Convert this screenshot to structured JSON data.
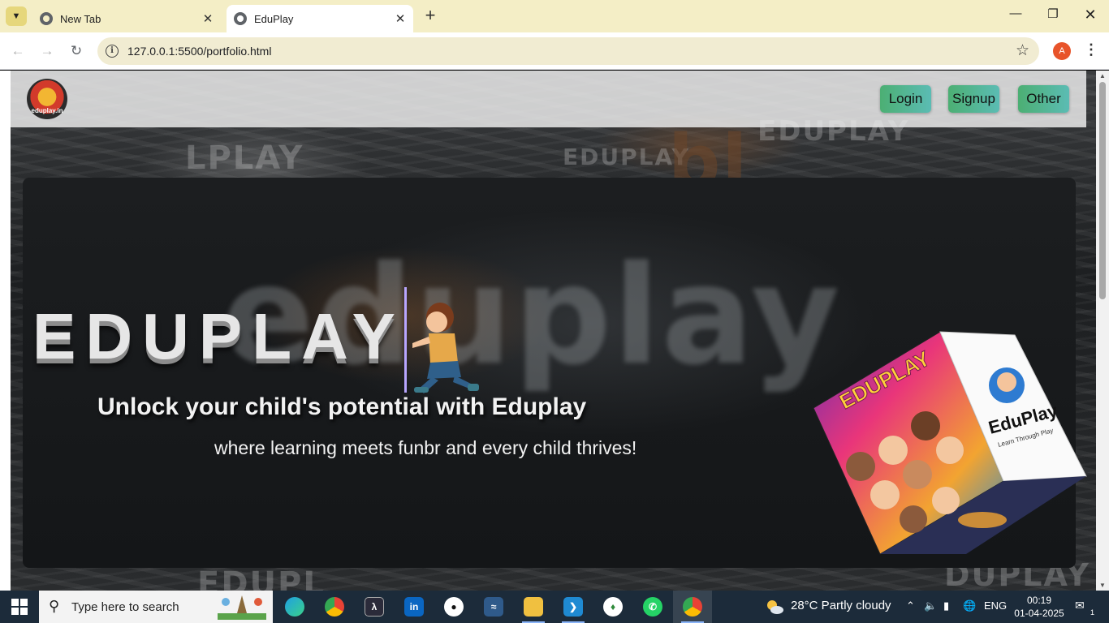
{
  "browser": {
    "tabs": [
      {
        "title": "New Tab",
        "active": false
      },
      {
        "title": "EduPlay",
        "active": true
      }
    ],
    "url": "127.0.0.1:5500/portfolio.html",
    "profile_initial": "A"
  },
  "site": {
    "logo_text": "eduplay.in",
    "nav": [
      {
        "label": "Login"
      },
      {
        "label": "Signup"
      },
      {
        "label": "Other"
      }
    ]
  },
  "hero": {
    "title": "EDUPLAY",
    "background_word": "eduplay",
    "tagline": "Unlock your child's potential with Eduplay",
    "subtitle": "where learning meets funbr and every child thrives!",
    "cube_front_title": "EDUPLAY",
    "cube_side_title": "EduPlay",
    "cube_side_sub": "Learn Through Play"
  },
  "taskbar": {
    "search_placeholder": "Type here to search",
    "weather": "28°C  Partly cloudy",
    "language": "ENG",
    "time": "00:19",
    "date": "01-04-2025",
    "notification_count": "1"
  }
}
